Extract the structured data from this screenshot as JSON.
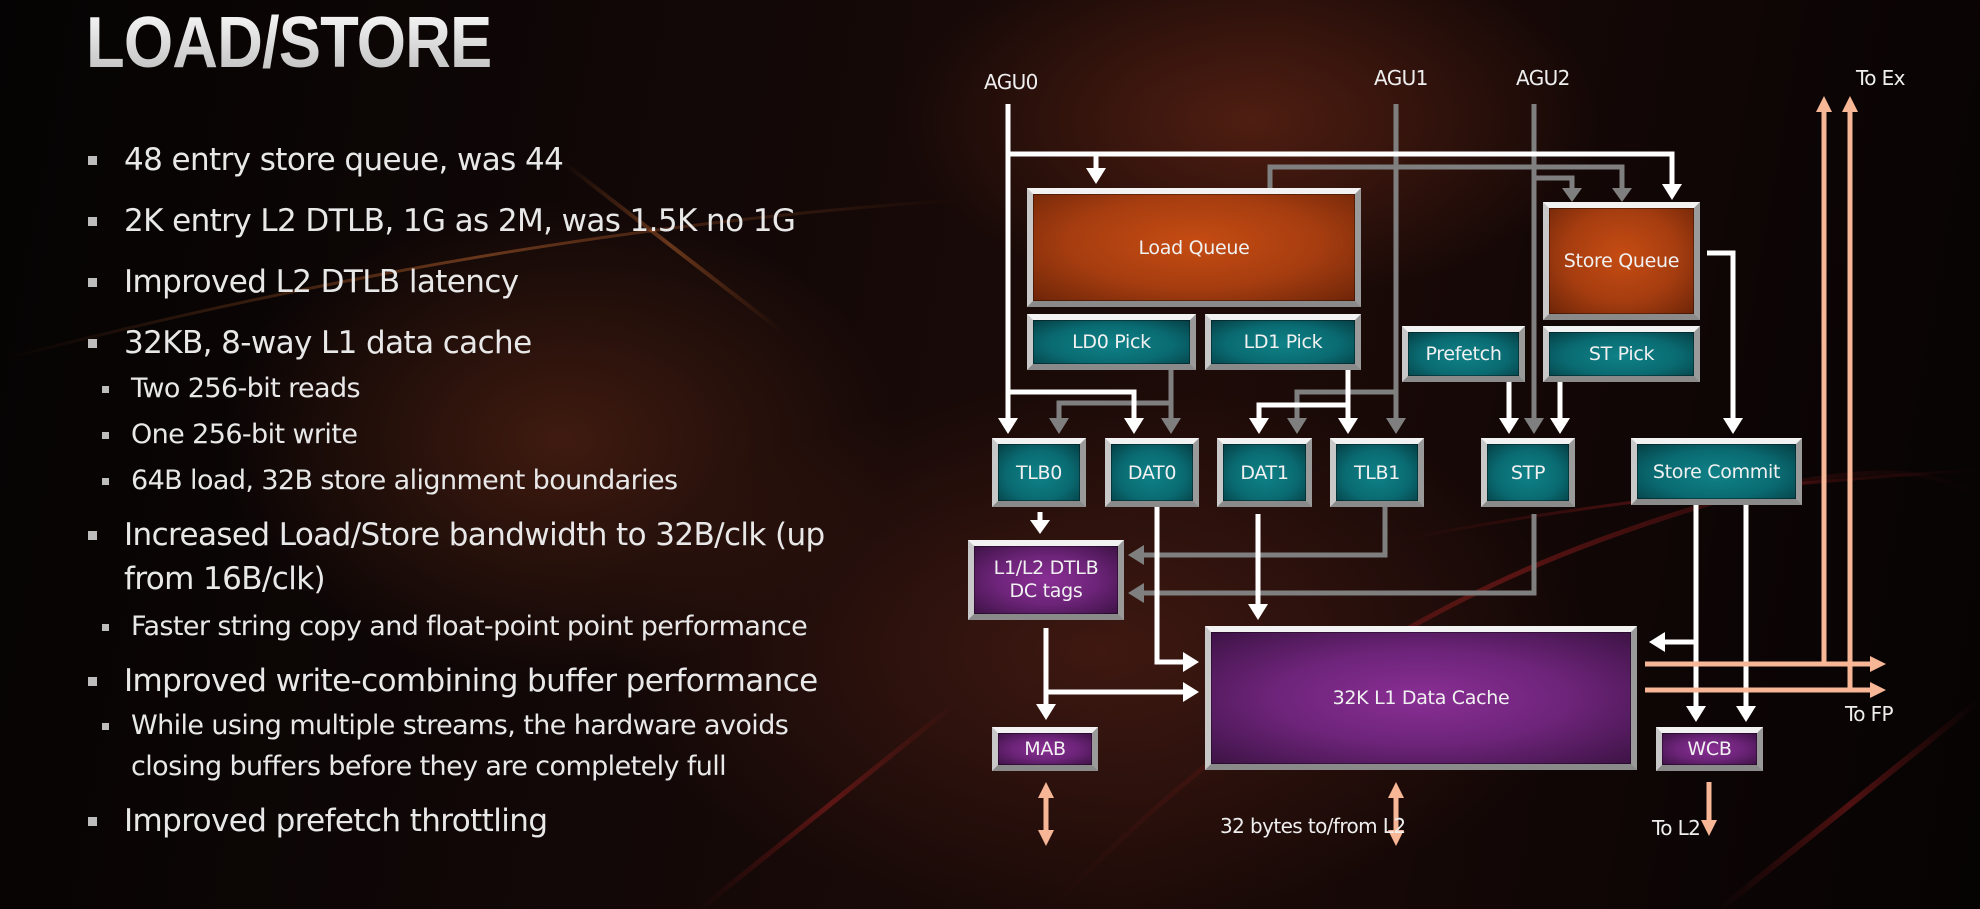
{
  "slide": {
    "title": "LOAD/STORE",
    "bullets": [
      {
        "level": 1,
        "text": "48 entry store queue, was 44"
      },
      {
        "level": 1,
        "text": "2K entry L2 DTLB, 1G as 2M, was 1.5K no 1G"
      },
      {
        "level": 1,
        "text": "Improved L2 DTLB latency"
      },
      {
        "level": 1,
        "text": "32KB, 8-way L1 data cache"
      },
      {
        "level": 2,
        "text": "Two 256-bit reads"
      },
      {
        "level": 2,
        "text": "One 256-bit write"
      },
      {
        "level": 2,
        "text": "64B load, 32B store alignment boundaries"
      },
      {
        "level": 1,
        "text": "Increased Load/Store bandwidth to 32B/clk (up",
        "text2": "from 16B/clk)"
      },
      {
        "level": 2,
        "text": "Faster string copy and float-point point performance"
      },
      {
        "level": 1,
        "text": "Improved write-combining buffer performance"
      },
      {
        "level": 2,
        "text": "While using multiple streams, the hardware avoids",
        "text2": "closing buffers before they are completely full"
      },
      {
        "level": 1,
        "text": "Improved prefetch throttling"
      }
    ]
  },
  "diagram": {
    "inputs": {
      "agu0": "AGU0",
      "agu1": "AGU1",
      "agu2": "AGU2"
    },
    "blocks": {
      "load_queue": "Load Queue",
      "store_queue": "Store Queue",
      "ld0_pick": "LD0 Pick",
      "ld1_pick": "LD1 Pick",
      "prefetch": "Prefetch",
      "st_pick": "ST Pick",
      "tlb0": "TLB0",
      "dat0": "DAT0",
      "dat1": "DAT1",
      "tlb1": "TLB1",
      "stp": "STP",
      "store_commit": "Store Commit",
      "dtlb_line1": "L1/L2 DTLB",
      "dtlb_line2": "DC tags",
      "l1_cache": "32K L1 Data Cache",
      "mab": "MAB",
      "wcb": "WCB"
    },
    "outputs": {
      "to_ex": "To Ex",
      "to_fp": "To FP",
      "to_l2": "To L2",
      "l2_bus": "32 bytes to/from L2"
    },
    "colors": {
      "load_store_queue": "#c64c12",
      "pipeline_block": "#0a7279",
      "cache_block": "#7a2887",
      "primary_path": "#ffffff",
      "secondary_path": "#808080",
      "external_path": "#f7b797"
    }
  }
}
